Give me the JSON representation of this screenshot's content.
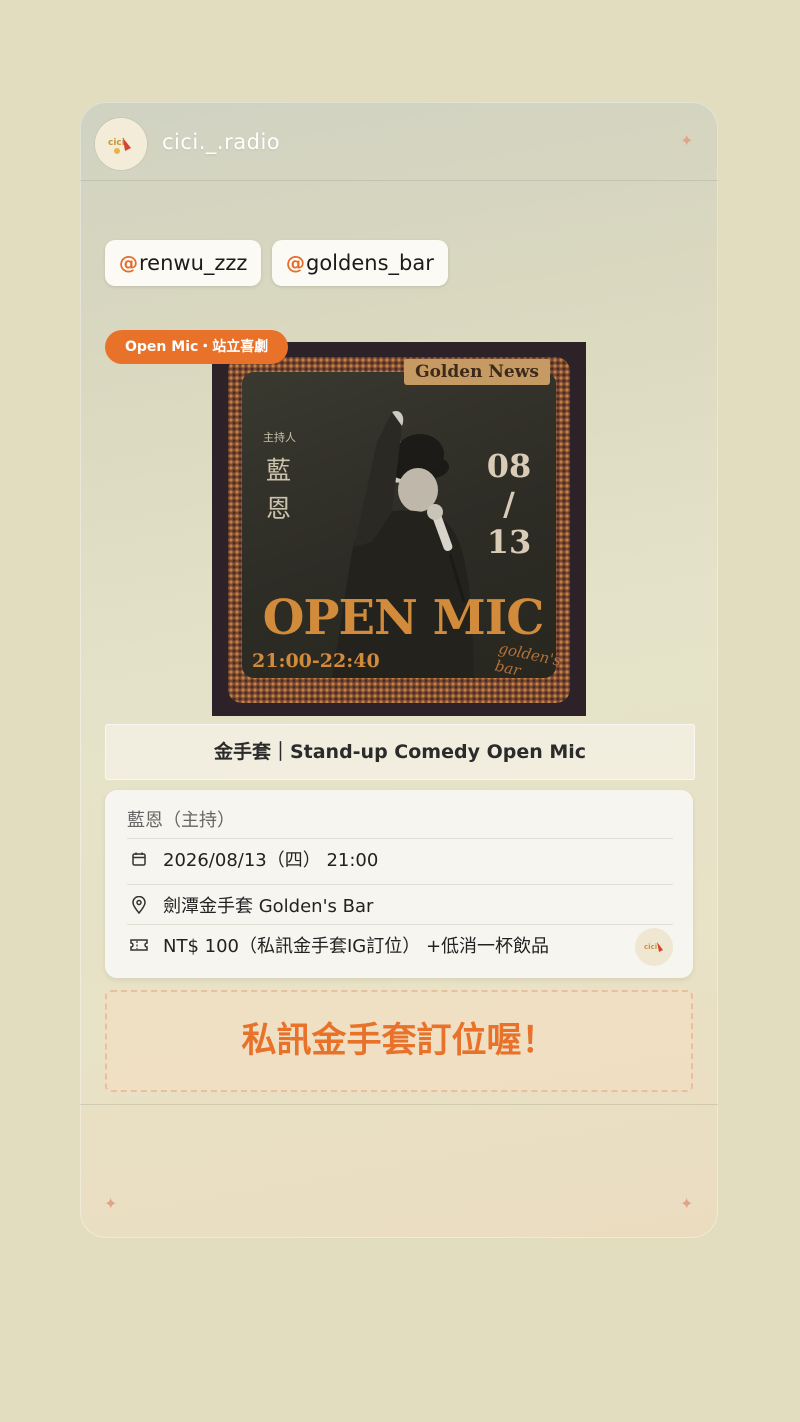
{
  "header": {
    "username": "cici._.radio"
  },
  "mentions": [
    {
      "icon": "threads-icon",
      "handle": "renwu_zzz"
    },
    {
      "icon": "threads-icon",
      "handle": "goldens_bar"
    }
  ],
  "tag": "Open Mic・站立喜劇",
  "poster": {
    "banner": "Golden News",
    "host_label": "主持人",
    "host_name": "藍恩",
    "date_month": "08",
    "date_slash": "/",
    "date_day": "13",
    "headline": "OPEN MIC",
    "time": "21:00-22:40",
    "signature": "golden's bar"
  },
  "event_title": "金手套｜Stand-up Comedy Open Mic",
  "info": {
    "host": "藍恩（主持）",
    "datetime": "2026/08/13（四） 21:00",
    "location": "劍潭金手套 Golden's Bar",
    "price": "NT$ 100（私訊金手套IG訂位） +低消一杯飲品"
  },
  "cta": "私訊金手套訂位喔！",
  "colors": {
    "accent": "#e8722a",
    "background": "#e2ddbf"
  }
}
